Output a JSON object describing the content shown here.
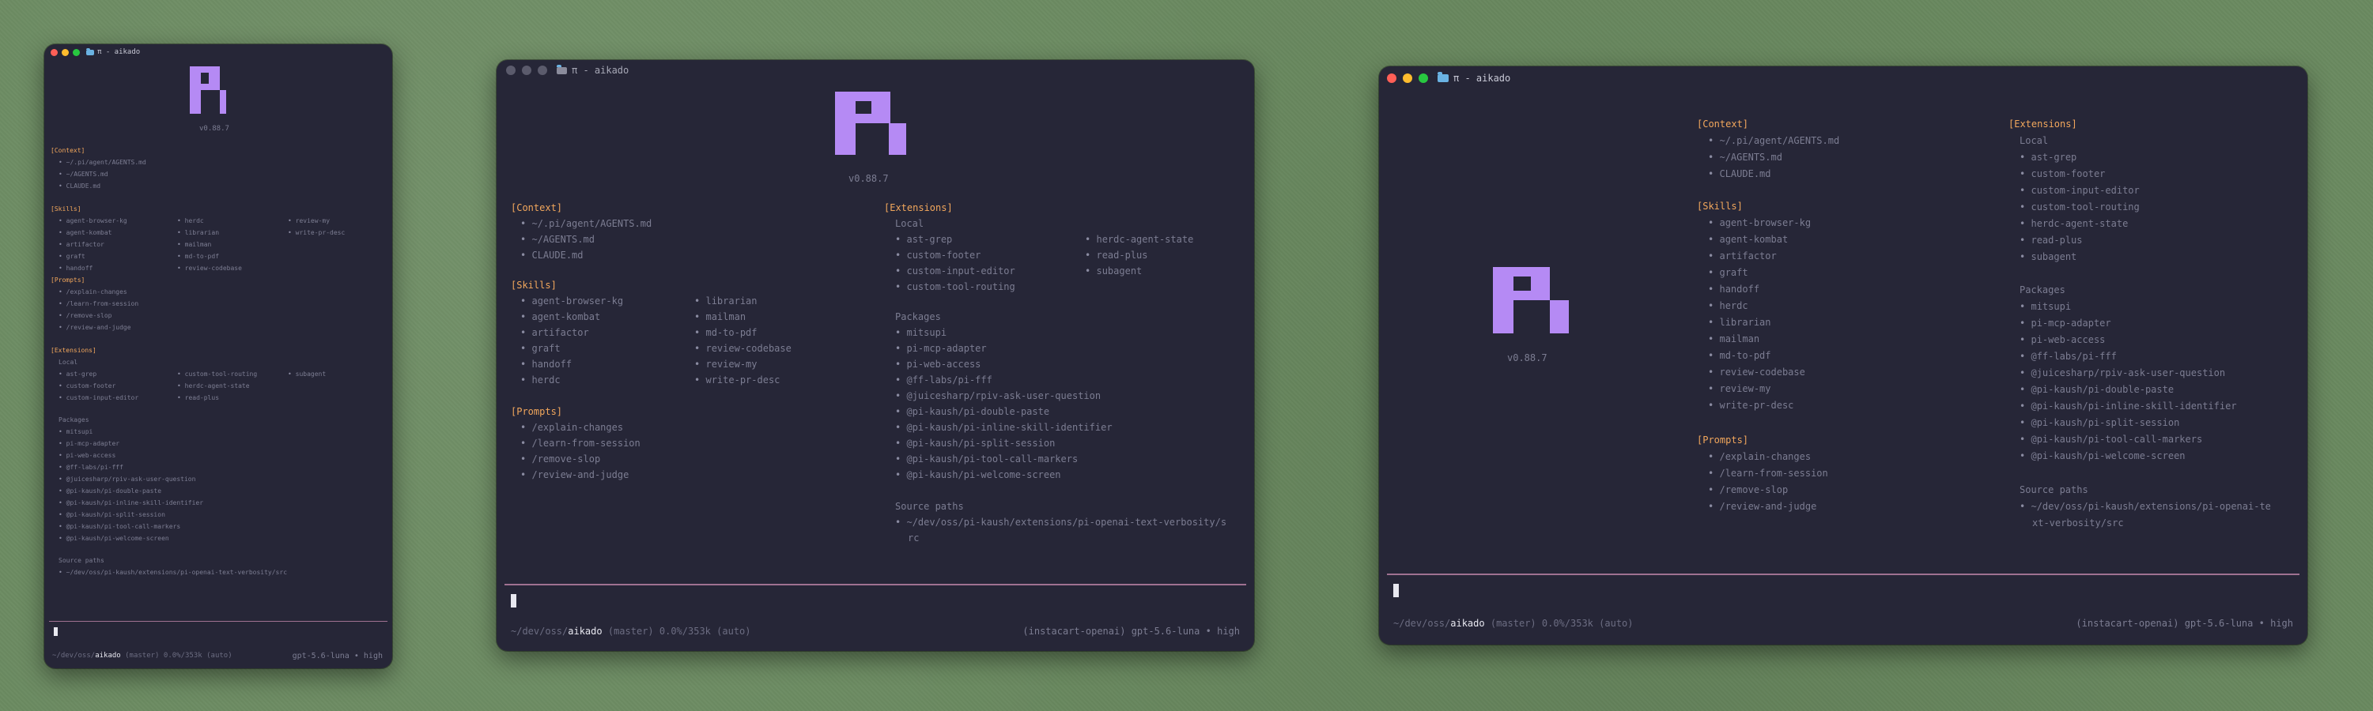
{
  "window_title": "π - aikado",
  "version": "v0.88.7",
  "headers": {
    "context": "[Context]",
    "skills": "[Skills]",
    "prompts": "[Prompts]",
    "extensions": "[Extensions]"
  },
  "subheaders": {
    "local": "Local",
    "packages": "Packages",
    "source_paths": "Source paths"
  },
  "bullet": "•",
  "context": [
    "~/.pi/agent/AGENTS.md",
    "~/AGENTS.md",
    "CLAUDE.md"
  ],
  "skills": [
    "agent-browser-kg",
    "agent-kombat",
    "artifactor",
    "graft",
    "handoff",
    "herdc",
    "librarian",
    "mailman",
    "md-to-pdf",
    "review-codebase",
    "review-my",
    "write-pr-desc"
  ],
  "prompts": [
    "/explain-changes",
    "/learn-from-session",
    "/remove-slop",
    "/review-and-judge"
  ],
  "extensions_local": [
    "ast-grep",
    "custom-footer",
    "custom-input-editor",
    "custom-tool-routing",
    "herdc-agent-state",
    "read-plus",
    "subagent"
  ],
  "packages": [
    "mitsupi",
    "pi-mcp-adapter",
    "pi-web-access",
    "@ff-labs/pi-fff",
    "@juicesharp/rpiv-ask-user-question",
    "@pi-kaush/pi-double-paste",
    "@pi-kaush/pi-inline-skill-identifier",
    "@pi-kaush/pi-split-session",
    "@pi-kaush/pi-tool-call-markers",
    "@pi-kaush/pi-welcome-screen"
  ],
  "source_paths": [
    "~/dev/oss/pi-kaush/extensions/pi-openai-text-verbosity/src"
  ],
  "source_paths_wrapped_medium": [
    "~/dev/oss/pi-kaush/extensions/pi-openai-text-verbosity/s",
    "rc"
  ],
  "source_paths_wrapped_large": [
    "~/dev/oss/pi-kaush/extensions/pi-openai-te",
    "xt-verbosity/src"
  ],
  "status": {
    "path_prefix": "~/dev/oss/",
    "path_prefix_small": "~/dev/oss/",
    "repo": "aikado",
    "branch": "(master)",
    "usage": "0.0%/353k",
    "usage_small": "0.0%/353k",
    "mode": "(auto)",
    "provider": "(instacart-openai)",
    "model": "gpt-5.6-luna",
    "separator": "•",
    "effort": "high"
  },
  "colors": {
    "background": "#262637",
    "accent": "#b58af4",
    "header": "#f2a75c",
    "divider": "#c88bb0"
  }
}
